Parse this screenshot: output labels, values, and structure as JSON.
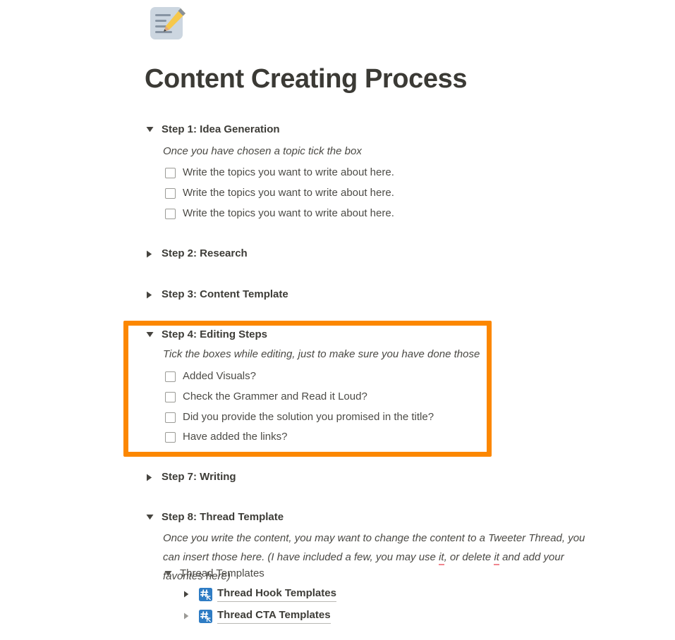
{
  "page": {
    "icon": "memo-pencil-icon",
    "title": "Content Creating Process"
  },
  "colors": {
    "highlight_border": "#fc8700",
    "link_icon_bg": "#2e7cc4",
    "spellcheck_underline": "#f0868f",
    "text": "#37352f"
  },
  "sections": [
    {
      "id": "step1",
      "toggle": "expanded",
      "label": "Step 1: Idea Generation",
      "note": "Once you have chosen a topic tick the box",
      "checkboxes": [
        {
          "label": "Write the topics you want to write about here.",
          "checked": false
        },
        {
          "label": "Write the topics you want to write about here.",
          "checked": false
        },
        {
          "label": "Write the topics you want to write about here.",
          "checked": false
        }
      ]
    },
    {
      "id": "step2",
      "toggle": "collapsed",
      "label": "Step 2: Research"
    },
    {
      "id": "step3",
      "toggle": "collapsed",
      "label": "Step 3: Content Template"
    },
    {
      "id": "step4",
      "toggle": "expanded",
      "highlighted": true,
      "label": "Step 4: Editing Steps",
      "note": "Tick the boxes while editing, just to make sure you have done those",
      "checkboxes": [
        {
          "label": "Added Visuals?",
          "checked": false
        },
        {
          "label": "Check the Grammer and Read it Loud?",
          "checked": false
        },
        {
          "label": "Did you provide the solution you promised in the title?",
          "checked": false
        },
        {
          "label": "Have added the links?",
          "checked": false
        }
      ]
    },
    {
      "id": "step7",
      "toggle": "collapsed",
      "label": "Step 7: Writing"
    },
    {
      "id": "step8",
      "toggle": "expanded",
      "label": "Step 8: Thread Template",
      "note_parts": {
        "line1": "Once you write the content, you may want to change the content to a Tweeter Thread, you can",
        "line2_a": "insert those here. (I have included a few, you may use ",
        "spell1": "it",
        "line2_b": ", or delete ",
        "spell2": "it",
        "line2_c": " and add your favorites here)"
      },
      "subsection": {
        "toggle": "expanded",
        "label": "Thread Templates",
        "links": [
          {
            "toggle": "collapsed",
            "icon": "hash-link-icon",
            "label": "Thread Hook Templates"
          },
          {
            "toggle": "collapsed",
            "icon": "hash-link-icon",
            "label": "Thread CTA Templates"
          }
        ]
      }
    }
  ]
}
